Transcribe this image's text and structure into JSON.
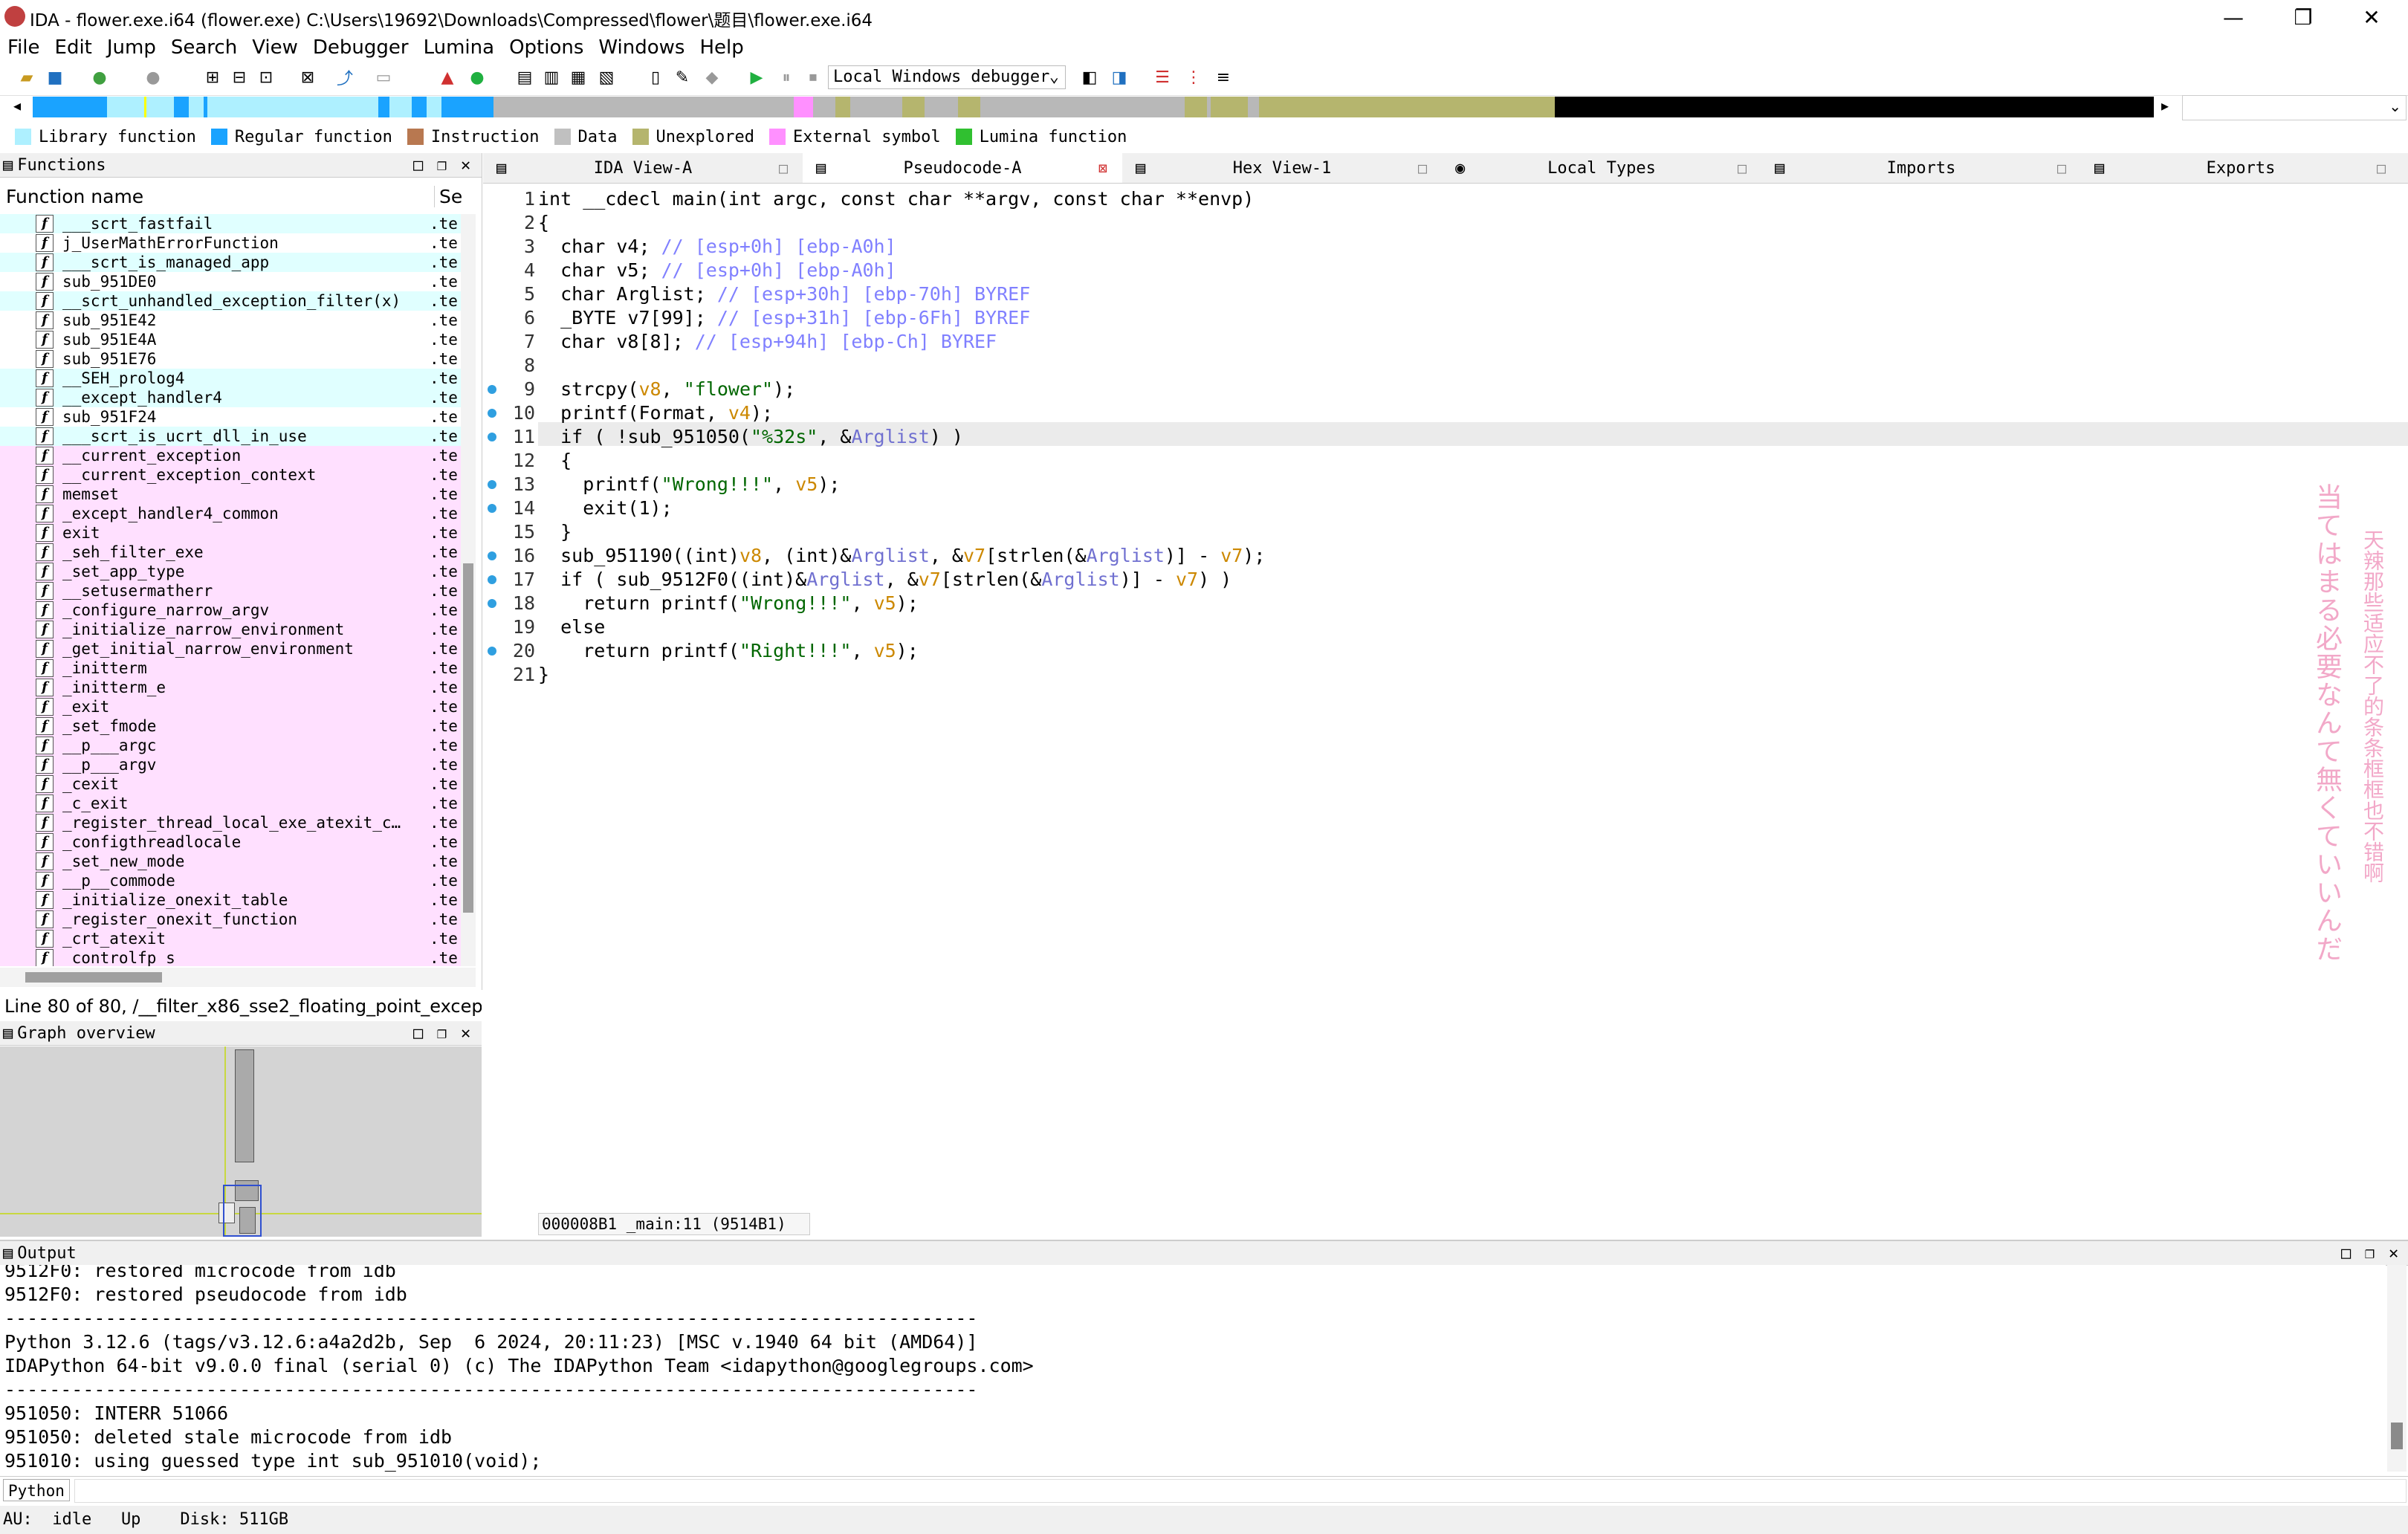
{
  "window": {
    "title": "IDA - flower.exe.i64 (flower.exe) C:\\Users\\19692\\Downloads\\Compressed\\flower\\题目\\flower.exe.i64",
    "minimize": "—",
    "maximize": "❐",
    "close": "✕"
  },
  "menu": [
    "File",
    "Edit",
    "Jump",
    "Search",
    "View",
    "Debugger",
    "Lumina",
    "Options",
    "Windows",
    "Help"
  ],
  "toolbar": {
    "debugger": "Local Windows debugger"
  },
  "legend": [
    {
      "label": "Library function",
      "color": "#aef0ff"
    },
    {
      "label": "Regular function",
      "color": "#1aa3ff"
    },
    {
      "label": "Instruction",
      "color": "#b87850"
    },
    {
      "label": "Data",
      "color": "#c0c0c0"
    },
    {
      "label": "Unexplored",
      "color": "#b5b56e"
    },
    {
      "label": "External symbol",
      "color": "#ff90ff"
    },
    {
      "label": "Lumina function",
      "color": "#30c030"
    }
  ],
  "functions_panel": {
    "title": "Functions",
    "col_name": "Function name",
    "col_seg": "Se",
    "rows": [
      {
        "name": "___scrt_fastfail",
        "seg": ".te",
        "bg": "#e0ffff"
      },
      {
        "name": "j_UserMathErrorFunction",
        "seg": ".te",
        "bg": "#ffffff"
      },
      {
        "name": "___scrt_is_managed_app",
        "seg": ".te",
        "bg": "#e0ffff"
      },
      {
        "name": "sub_951DE0",
        "seg": ".te",
        "bg": "#ffffff"
      },
      {
        "name": "__scrt_unhandled_exception_filter(x)",
        "seg": ".te",
        "bg": "#e0ffff"
      },
      {
        "name": "sub_951E42",
        "seg": ".te",
        "bg": "#ffffff"
      },
      {
        "name": "sub_951E4A",
        "seg": ".te",
        "bg": "#ffffff"
      },
      {
        "name": "sub_951E76",
        "seg": ".te",
        "bg": "#ffffff"
      },
      {
        "name": "__SEH_prolog4",
        "seg": ".te",
        "bg": "#e0ffff"
      },
      {
        "name": "__except_handler4",
        "seg": ".te",
        "bg": "#e0ffff"
      },
      {
        "name": "sub_951F24",
        "seg": ".te",
        "bg": "#ffffff"
      },
      {
        "name": "___scrt_is_ucrt_dll_in_use",
        "seg": ".te",
        "bg": "#e0ffff"
      },
      {
        "name": "__current_exception",
        "seg": ".te",
        "bg": "#ffe0ff"
      },
      {
        "name": "__current_exception_context",
        "seg": ".te",
        "bg": "#ffe0ff"
      },
      {
        "name": "memset",
        "seg": ".te",
        "bg": "#ffe0ff"
      },
      {
        "name": "_except_handler4_common",
        "seg": ".te",
        "bg": "#ffe0ff"
      },
      {
        "name": "exit",
        "seg": ".te",
        "bg": "#ffe0ff"
      },
      {
        "name": "_seh_filter_exe",
        "seg": ".te",
        "bg": "#ffe0ff"
      },
      {
        "name": "_set_app_type",
        "seg": ".te",
        "bg": "#ffe0ff"
      },
      {
        "name": "__setusermatherr",
        "seg": ".te",
        "bg": "#ffe0ff"
      },
      {
        "name": "_configure_narrow_argv",
        "seg": ".te",
        "bg": "#ffe0ff"
      },
      {
        "name": "_initialize_narrow_environment",
        "seg": ".te",
        "bg": "#ffe0ff"
      },
      {
        "name": "_get_initial_narrow_environment",
        "seg": ".te",
        "bg": "#ffe0ff"
      },
      {
        "name": "_initterm",
        "seg": ".te",
        "bg": "#ffe0ff"
      },
      {
        "name": "_initterm_e",
        "seg": ".te",
        "bg": "#ffe0ff"
      },
      {
        "name": "_exit",
        "seg": ".te",
        "bg": "#ffe0ff"
      },
      {
        "name": "_set_fmode",
        "seg": ".te",
        "bg": "#ffe0ff"
      },
      {
        "name": "__p___argc",
        "seg": ".te",
        "bg": "#ffe0ff"
      },
      {
        "name": "__p___argv",
        "seg": ".te",
        "bg": "#ffe0ff"
      },
      {
        "name": "_cexit",
        "seg": ".te",
        "bg": "#ffe0ff"
      },
      {
        "name": "_c_exit",
        "seg": ".te",
        "bg": "#ffe0ff"
      },
      {
        "name": "_register_thread_local_exe_atexit_c…",
        "seg": ".te",
        "bg": "#ffe0ff"
      },
      {
        "name": "_configthreadlocale",
        "seg": ".te",
        "bg": "#ffe0ff"
      },
      {
        "name": "_set_new_mode",
        "seg": ".te",
        "bg": "#ffe0ff"
      },
      {
        "name": "__p__commode",
        "seg": ".te",
        "bg": "#ffe0ff"
      },
      {
        "name": "_initialize_onexit_table",
        "seg": ".te",
        "bg": "#ffe0ff"
      },
      {
        "name": "_register_onexit_function",
        "seg": ".te",
        "bg": "#ffe0ff"
      },
      {
        "name": "_crt_atexit",
        "seg": ".te",
        "bg": "#ffe0ff"
      },
      {
        "name": "_controlfp_s",
        "seg": ".te",
        "bg": "#ffe0ff"
      }
    ],
    "status": "Line 80 of 80, /__filter_x86_sse2_floating_point_exceptic"
  },
  "graph_panel": {
    "title": "Graph overview"
  },
  "tabs": [
    {
      "label": "IDA View-A",
      "active": false
    },
    {
      "label": "Pseudocode-A",
      "active": true
    },
    {
      "label": "Hex View-1",
      "active": false
    },
    {
      "label": "Local Types",
      "active": false
    },
    {
      "label": "Imports",
      "active": false
    },
    {
      "label": "Exports",
      "active": false
    }
  ],
  "code": {
    "lines": [
      {
        "n": "1",
        "bp": false,
        "parts": [
          [
            "",
            "int __cdecl main(int argc, const char **argv, const char **envp)"
          ]
        ]
      },
      {
        "n": "2",
        "bp": false,
        "parts": [
          [
            "",
            "{"
          ]
        ]
      },
      {
        "n": "3",
        "bp": false,
        "parts": [
          [
            "",
            "  char v4; "
          ],
          [
            "cm",
            "// [esp+0h] [ebp-A0h]"
          ]
        ]
      },
      {
        "n": "4",
        "bp": false,
        "parts": [
          [
            "",
            "  char v5; "
          ],
          [
            "cm",
            "// [esp+0h] [ebp-A0h]"
          ]
        ]
      },
      {
        "n": "5",
        "bp": false,
        "parts": [
          [
            "",
            "  char Arglist; "
          ],
          [
            "cm",
            "// [esp+30h] [ebp-70h] BYREF"
          ]
        ]
      },
      {
        "n": "6",
        "bp": false,
        "parts": [
          [
            "",
            "  _BYTE v7[99]; "
          ],
          [
            "cm",
            "// [esp+31h] [ebp-6Fh] BYREF"
          ]
        ]
      },
      {
        "n": "7",
        "bp": false,
        "parts": [
          [
            "",
            "  char v8[8]; "
          ],
          [
            "cm",
            "// [esp+94h] [ebp-Ch] BYREF"
          ]
        ]
      },
      {
        "n": "8",
        "bp": false,
        "parts": [
          [
            "",
            ""
          ]
        ]
      },
      {
        "n": "9",
        "bp": true,
        "parts": [
          [
            "",
            "  strcpy("
          ],
          [
            "var",
            "v8"
          ],
          [
            "",
            ", "
          ],
          [
            "str",
            "\"flower\""
          ],
          [
            "",
            ");"
          ]
        ]
      },
      {
        "n": "10",
        "bp": true,
        "parts": [
          [
            "",
            "  printf(Format, "
          ],
          [
            "var",
            "v4"
          ],
          [
            "",
            ");"
          ]
        ]
      },
      {
        "n": "11",
        "bp": true,
        "parts": [
          [
            "",
            "  if ( !sub_951050("
          ],
          [
            "str",
            "\"%32s\""
          ],
          [
            "",
            ", &"
          ],
          [
            "gvar",
            "Arglist"
          ],
          [
            "",
            ") )"
          ]
        ]
      },
      {
        "n": "12",
        "bp": false,
        "parts": [
          [
            "",
            "  {"
          ]
        ]
      },
      {
        "n": "13",
        "bp": true,
        "parts": [
          [
            "",
            "    printf("
          ],
          [
            "str",
            "\"Wrong!!!\""
          ],
          [
            "",
            ", "
          ],
          [
            "var",
            "v5"
          ],
          [
            "",
            ");"
          ]
        ]
      },
      {
        "n": "14",
        "bp": true,
        "parts": [
          [
            "",
            "    exit(1);"
          ]
        ]
      },
      {
        "n": "15",
        "bp": false,
        "parts": [
          [
            "",
            "  }"
          ]
        ]
      },
      {
        "n": "16",
        "bp": true,
        "parts": [
          [
            "",
            "  sub_951190((int)"
          ],
          [
            "var",
            "v8"
          ],
          [
            "",
            ", (int)&"
          ],
          [
            "gvar",
            "Arglist"
          ],
          [
            "",
            ", &"
          ],
          [
            "var",
            "v7"
          ],
          [
            "",
            "[strlen(&"
          ],
          [
            "gvar",
            "Arglist"
          ],
          [
            "",
            ")] - "
          ],
          [
            "var",
            "v7"
          ],
          [
            "",
            ");"
          ]
        ]
      },
      {
        "n": "17",
        "bp": true,
        "parts": [
          [
            "",
            "  if ( sub_9512F0((int)&"
          ],
          [
            "gvar",
            "Arglist"
          ],
          [
            "",
            ", &"
          ],
          [
            "var",
            "v7"
          ],
          [
            "",
            "[strlen(&"
          ],
          [
            "gvar",
            "Arglist"
          ],
          [
            "",
            ")] - "
          ],
          [
            "var",
            "v7"
          ],
          [
            "",
            ") )"
          ]
        ]
      },
      {
        "n": "18",
        "bp": true,
        "parts": [
          [
            "",
            "    return printf("
          ],
          [
            "str",
            "\"Wrong!!!\""
          ],
          [
            "",
            ", "
          ],
          [
            "var",
            "v5"
          ],
          [
            "",
            ");"
          ]
        ]
      },
      {
        "n": "19",
        "bp": false,
        "parts": [
          [
            "",
            "  else"
          ]
        ]
      },
      {
        "n": "20",
        "bp": true,
        "parts": [
          [
            "",
            "    return printf("
          ],
          [
            "str",
            "\"Right!!!\""
          ],
          [
            "",
            ", "
          ],
          [
            "var",
            "v5"
          ],
          [
            "",
            ");"
          ]
        ]
      },
      {
        "n": "21",
        "bp": false,
        "parts": [
          [
            "",
            "}"
          ]
        ]
      }
    ],
    "status": "000008B1 _main:11 (9514B1)"
  },
  "watermark": {
    "col1": "当てはまる必要なんて無くていいんだ",
    "col2": "天辣那些适应不了的条条框框也不错啊"
  },
  "output": {
    "title": "Output",
    "lines": [
      "9512F0: restored microcode from idb",
      "9512F0: restored pseudocode from idb",
      "---------------------------------------------------------------------------------------",
      "Python 3.12.6 (tags/v3.12.6:a4a2d2b, Sep  6 2024, 20:11:23) [MSC v.1940 64 bit (AMD64)]",
      "IDAPython 64-bit v9.0.0 final (serial 0) (c) The IDAPython Team <idapython@googlegroups.com>",
      "---------------------------------------------------------------------------------------",
      "951050: INTERR 51066",
      "951050: deleted stale microcode from idb",
      "951010: using guessed type int sub_951010(void);"
    ],
    "python_label": "Python"
  },
  "statusbar": {
    "text": "AU:  idle   Up    Disk: 511GB"
  }
}
